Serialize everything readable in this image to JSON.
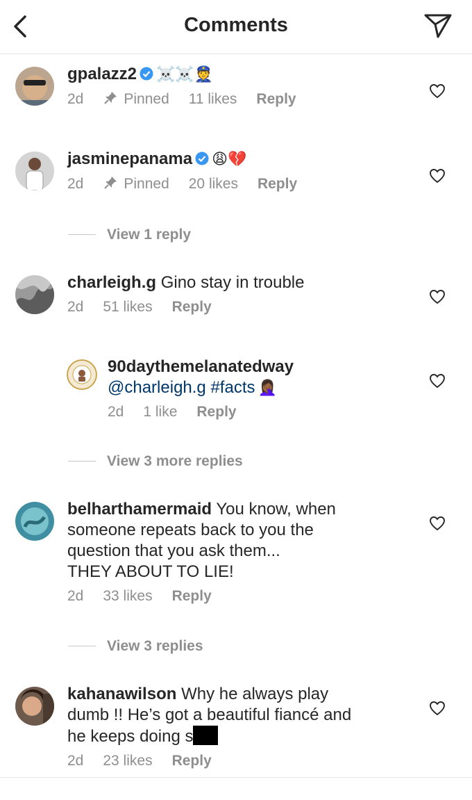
{
  "header": {
    "title": "Comments"
  },
  "comments": [
    {
      "username": "gpalazz2",
      "verified": true,
      "text": "",
      "emojis": "☠️☠️👮",
      "time": "2d",
      "pinned_label": "Pinned",
      "likes": "11 likes",
      "reply": "Reply"
    },
    {
      "username": "jasminepanama",
      "verified": true,
      "text": "",
      "emojis": "😩💔",
      "time": "2d",
      "pinned_label": "Pinned",
      "likes": "20 likes",
      "reply": "Reply",
      "view_replies": "View 1 reply"
    },
    {
      "username": "charleigh.g",
      "verified": false,
      "text": "Gino stay in trouble",
      "time": "2d",
      "likes": "51 likes",
      "reply": "Reply",
      "replies": [
        {
          "username": "90daythemelanatedway",
          "mention": "@charleigh.g",
          "text": "#facts",
          "emojis": "🤦🏾‍♀️",
          "time": "2d",
          "likes": "1 like",
          "reply": "Reply"
        }
      ],
      "view_replies": "View 3 more replies"
    },
    {
      "username": "belharthamermaid",
      "verified": false,
      "text_lines": [
        "You know, when",
        "someone repeats back to you the",
        "question that you ask them...",
        "THEY ABOUT TO LIE!"
      ],
      "time": "2d",
      "likes": "33 likes",
      "reply": "Reply",
      "view_replies": "View 3 replies"
    },
    {
      "username": "kahanawilson",
      "verified": false,
      "text_lines": [
        "Why he always play",
        "dumb !! He’s got a beautiful fiancé and",
        "he keeps doing s"
      ],
      "time": "2d",
      "likes": "23 likes",
      "reply": "Reply"
    }
  ]
}
